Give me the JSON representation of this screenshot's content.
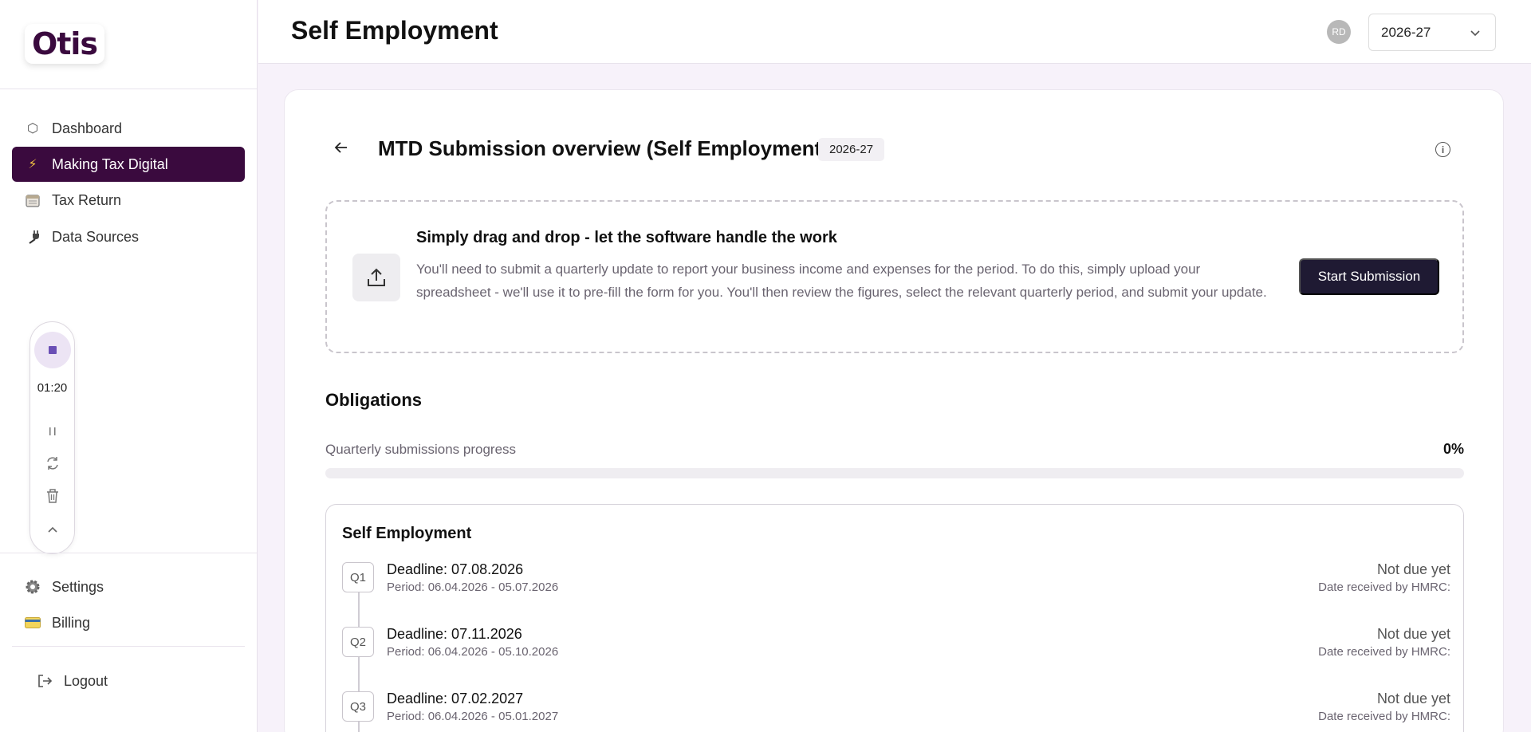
{
  "sidebar": {
    "logo": "Otis",
    "nav": [
      {
        "label": "Dashboard",
        "icon": "hexagon-icon"
      },
      {
        "label": "Making Tax Digital",
        "icon": "lightning-icon",
        "active": true
      },
      {
        "label": "Tax Return",
        "icon": "calendar-icon"
      },
      {
        "label": "Data Sources",
        "icon": "plug-icon"
      }
    ],
    "bottom_nav": [
      {
        "label": "Settings",
        "icon": "gear-icon"
      },
      {
        "label": "Billing",
        "icon": "credit-card-icon"
      }
    ],
    "logout": "Logout"
  },
  "recorder": {
    "time": "01:20"
  },
  "header": {
    "title": "Self Employment",
    "avatar_initials": "RD",
    "year_selected": "2026-27"
  },
  "card": {
    "title": "MTD Submission overview (Self Employment)",
    "year_badge": "2026-27",
    "dropzone": {
      "title": "Simply drag and drop - let the software handle the work",
      "text": "You'll need to submit a quarterly update to report your business income and expenses for the period. To do this, simply upload your spreadsheet - we'll use it to pre-fill the form for you. You'll then review the figures, select the relevant quarterly period, and submit your update.",
      "button": "Start Submission"
    },
    "obligations": {
      "title": "Obligations",
      "progress_label": "Quarterly submissions progress",
      "progress_value": "0%",
      "progress_fraction": 0
    },
    "self_employment": {
      "title": "Self Employment",
      "quarters": [
        {
          "badge": "Q1",
          "deadline": "Deadline: 07.08.2026",
          "period": "Period: 06.04.2026 - 05.07.2026",
          "status": "Not due yet",
          "received": "Date received by HMRC:"
        },
        {
          "badge": "Q2",
          "deadline": "Deadline: 07.11.2026",
          "period": "Period: 06.04.2026 - 05.10.2026",
          "status": "Not due yet",
          "received": "Date received by HMRC:"
        },
        {
          "badge": "Q3",
          "deadline": "Deadline: 07.02.2027",
          "period": "Period: 06.04.2026 - 05.01.2027",
          "status": "Not due yet",
          "received": "Date received by HMRC:"
        }
      ]
    }
  },
  "colors": {
    "brand": "#3a0a3e",
    "button_dark": "#1f1a33",
    "background": "#f7f2fa"
  }
}
